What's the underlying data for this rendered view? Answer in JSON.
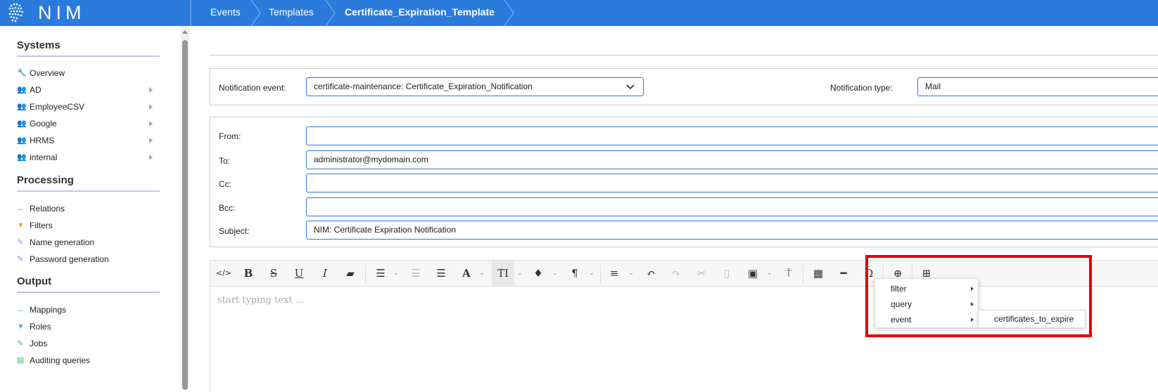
{
  "app": {
    "logo_text": "NIM",
    "brand_color": "#2b7bdc"
  },
  "breadcrumb": [
    "Events",
    "Templates",
    "Certificate_Expiration_Template"
  ],
  "sidebar": {
    "sections": [
      {
        "title": "Systems",
        "items": [
          {
            "label": "Overview",
            "icon": "wrench-icon",
            "submenu": false
          },
          {
            "label": "AD",
            "icon": "users-icon",
            "submenu": true
          },
          {
            "label": "EmployeeCSV",
            "icon": "users-icon",
            "submenu": true
          },
          {
            "label": "Google",
            "icon": "users-icon",
            "submenu": true
          },
          {
            "label": "HRMS",
            "icon": "users-icon",
            "submenu": true
          },
          {
            "label": "internal",
            "icon": "users-icon",
            "submenu": true
          }
        ]
      },
      {
        "title": "Processing",
        "items": [
          {
            "label": "Relations",
            "icon": "arrows-icon"
          },
          {
            "label": "Filters",
            "icon": "filter-icon"
          },
          {
            "label": "Name generation",
            "icon": "edit-icon"
          },
          {
            "label": "Password generation",
            "icon": "edit-icon"
          }
        ]
      },
      {
        "title": "Output",
        "items": [
          {
            "label": "Mappings",
            "icon": "arrows-icon"
          },
          {
            "label": "Roles",
            "icon": "filter-icon"
          },
          {
            "label": "Jobs",
            "icon": "edit-icon"
          },
          {
            "label": "Auditing queries",
            "icon": "document-icon"
          }
        ]
      }
    ]
  },
  "notification": {
    "event_label": "Notification event:",
    "event_value": "certificate-maintenance: Certificate_Expiration_Notification",
    "type_label": "Notification type:",
    "type_value": "Mail"
  },
  "mail": {
    "from_label": "From:",
    "from_value": "",
    "to_label": "To:",
    "to_value": "administrator@mydomain.com",
    "cc_label": "Cc:",
    "cc_value": "",
    "bcc_label": "Bcc:",
    "bcc_value": "",
    "subject_label": "Subject:",
    "subject_value": "NIM: Certificate Expiration Notification"
  },
  "editor": {
    "placeholder": "start typing text ...",
    "insert_menu": [
      "filter",
      "query",
      "event"
    ],
    "event_submenu": [
      "certificates_to_expire"
    ]
  },
  "highlight_color": "#e50000"
}
